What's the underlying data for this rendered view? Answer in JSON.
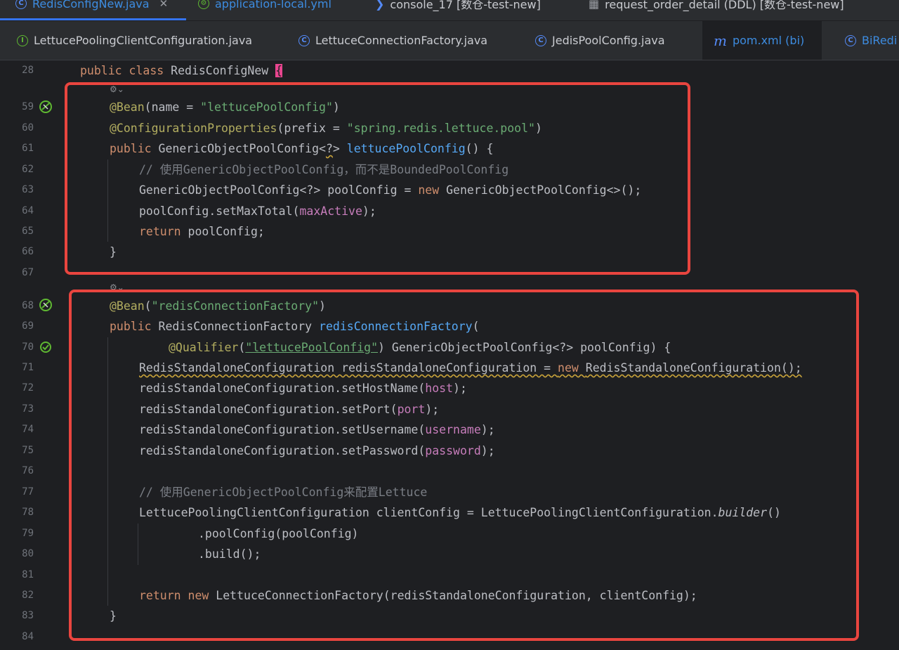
{
  "top_tabs": [
    {
      "label": "RedisConfigNew.java",
      "active": true,
      "icon": "class-icon"
    },
    {
      "label": "application-local.yml",
      "active": false,
      "icon": "yaml-settings-icon"
    },
    {
      "label": "console_17 [数仓-test-new]",
      "active": false,
      "icon": "console-icon"
    },
    {
      "label": "request_order_detail (DDL) [数仓-test-new]",
      "active": false,
      "icon": "table-icon"
    }
  ],
  "second_tabs": [
    {
      "label": "LettucePoolingClientConfiguration.java",
      "icon": "interface-icon"
    },
    {
      "label": "LettuceConnectionFactory.java",
      "icon": "class-icon"
    },
    {
      "label": "JedisPoolConfig.java",
      "icon": "class-icon"
    },
    {
      "label": "pom.xml (bi)",
      "icon": "maven-icon"
    },
    {
      "label": "BiRedi",
      "icon": "class-icon"
    }
  ],
  "line_numbers": [
    "28",
    "59",
    "60",
    "61",
    "62",
    "63",
    "64",
    "65",
    "66",
    "67",
    "68",
    "69",
    "70",
    "71",
    "72",
    "73",
    "74",
    "75",
    "76",
    "77",
    "78",
    "79",
    "80",
    "81",
    "82",
    "83",
    "84"
  ],
  "code": {
    "l28": {
      "kw": "public class ",
      "cls": "RedisConfigNew ",
      "brace": "{"
    },
    "l59": {
      "ann": "@Bean",
      "rest1": "(name = ",
      "str": "\"lettucePoolConfig\"",
      "rest2": ")"
    },
    "l60": {
      "ann": "@ConfigurationProperties",
      "rest1": "(prefix = ",
      "str": "\"spring.redis.lettuce.pool\"",
      "rest2": ")"
    },
    "l61": {
      "kw": "public ",
      "type": "GenericObjectPoolConfig<",
      "wild": "?",
      "type2": "> ",
      "fn": "lettucePoolConfig",
      "rest": "() {"
    },
    "l62": {
      "cmt": "// 使用GenericObjectPoolConfig，而不是BoundedPoolConfig"
    },
    "l63": {
      "type": "GenericObjectPoolConfig<?> poolConfig = ",
      "kw": "new ",
      "rest": "GenericObjectPoolConfig<>();"
    },
    "l64": {
      "pre": "poolConfig.setMaxTotal(",
      "fld": "maxActive",
      "post": ");"
    },
    "l65": {
      "kw": "return ",
      "rest": "poolConfig;"
    },
    "l66": {
      "rest": "}"
    },
    "l68": {
      "ann": "@Bean",
      "rest1": "(",
      "str": "\"redisConnectionFactory\"",
      "rest2": ")"
    },
    "l69": {
      "kw": "public ",
      "type": "RedisConnectionFactory ",
      "fn": "redisConnectionFactory",
      "rest": "("
    },
    "l70": {
      "ann": "@Qualifier",
      "rest1": "(",
      "str": "\"lettucePoolConfig\"",
      "rest2": ") GenericObjectPoolConfig<?> poolConfig) {"
    },
    "l71": {
      "type": "RedisStandaloneConfiguration redisStandaloneConfiguration = ",
      "kw": "new ",
      "rest": "RedisStandaloneConfiguration();"
    },
    "l72": {
      "pre": "redisStandaloneConfiguration.setHostName(",
      "fld": "host",
      "post": ");"
    },
    "l73": {
      "pre": "redisStandaloneConfiguration.setPort(",
      "fld": "port",
      "post": ");"
    },
    "l74": {
      "pre": "redisStandaloneConfiguration.setUsername(",
      "fld": "username",
      "post": ");"
    },
    "l75": {
      "pre": "redisStandaloneConfiguration.setPassword(",
      "fld": "password",
      "post": ");"
    },
    "l77": {
      "cmt": "// 使用GenericObjectPoolConfig来配置Lettuce"
    },
    "l78": {
      "pre": "LettucePoolingClientConfiguration clientConfig = LettucePoolingClientConfiguration.",
      "ital": "builder",
      "post": "()"
    },
    "l79": {
      "rest": ".poolConfig(poolConfig)"
    },
    "l80": {
      "rest": ".build();"
    },
    "l82": {
      "kw1": "return ",
      "kw2": "new ",
      "rest": "LettuceConnectionFactory(redisStandaloneConfiguration, clientConfig);"
    },
    "l83": {
      "rest": "}"
    }
  },
  "colors": {
    "background": "#1e1f22",
    "highlight_box": "#e9453f",
    "keyword": "#cf8e6d",
    "annotation": "#b3ae60",
    "string": "#6aab73",
    "method": "#56a8f5",
    "field": "#c77dbb",
    "comment": "#7a7e85"
  }
}
